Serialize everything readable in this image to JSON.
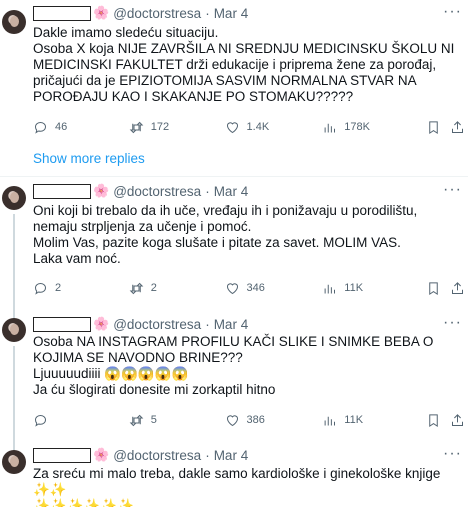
{
  "tweets": [
    {
      "handle": "@doctorstresa",
      "date": "Mar 4",
      "text": "Dakle imamo sledeću situaciju.\nOsoba X koja NIJE ZAVRŠILA NI SREDNJU MEDICINSKU ŠKOLU NI MEDICINSKI FAKULTET drži edukacije i priprema žene za porođaj, pričajući da je EPIZIOTOMIJA SASVIM NORMALNA STVAR NA POROĐAJU KAO I SKAKANJE PO STOMAKU?????",
      "replies": "46",
      "retweets": "172",
      "likes": "1.4K",
      "views": "178K"
    },
    {
      "handle": "@doctorstresa",
      "date": "Mar 4",
      "text": "Oni koji bi trebalo da ih uče, vređaju ih i ponižavaju u porodilištu, nemaju strpljenja za učenje i pomoć.\nMolim Vas, pazite koga slušate i pitate za savet. MOLIM VAS.\nLaka vam noć.",
      "replies": "2",
      "retweets": "2",
      "likes": "346",
      "views": "11K"
    },
    {
      "handle": "@doctorstresa",
      "date": "Mar 4",
      "text": "Osoba NA INSTAGRAM PROFILU KAČI SLIKE I SNIMKE BEBA O KOJIMA SE NAVODNO BRINE???\nLjuuuuudiiii 😱😱😱😱😱\nJa ću šlogirati donesite mi zorkaptil hitno",
      "replies": "",
      "retweets": "5",
      "likes": "386",
      "views": "11K"
    },
    {
      "handle": "@doctorstresa",
      "date": "Mar 4",
      "text": "Za sreću mi malo treba, dakle samo kardiološke i ginekološke knjige ✨✨\n✨✨✨✨✨✨"
    }
  ],
  "show_more_replies": "Show more replies",
  "separator": "·",
  "more_label": "···",
  "flower": "🌸",
  "colors": {
    "link": "#1d9bf0",
    "muted": "#536471",
    "text": "#0f1419"
  }
}
